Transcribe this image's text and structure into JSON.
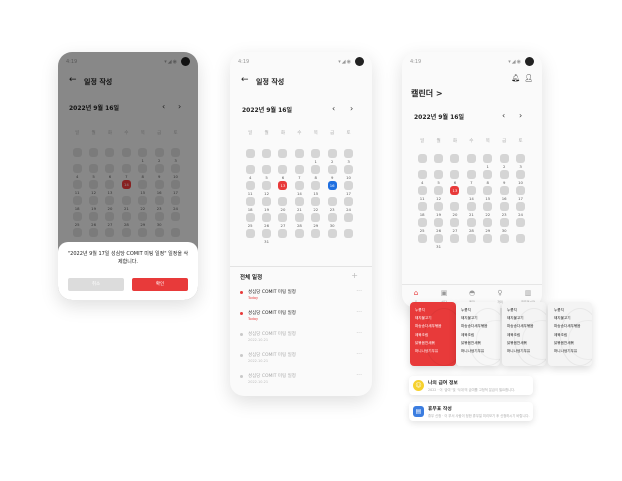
{
  "status": {
    "time": "4:19",
    "icons": "▾◢◉"
  },
  "colors": {
    "accent": "#e83a3a",
    "selected": "#1f6fe0",
    "day_block": "#d5d5d5"
  },
  "icons": {
    "back": "back-arrow-icon",
    "prev": "chevron-left-icon",
    "next": "chevron-right-icon",
    "bell": "bell-icon",
    "profile": "person-icon"
  },
  "weekdays": [
    "일",
    "월",
    "화",
    "수",
    "목",
    "금",
    "토"
  ],
  "screen1": {
    "title": "일정 작성",
    "month": "2022년 9월 16일",
    "dialog": {
      "message": "\"2022년 9월 17일 성심당 COMIT 미팅 일정\" 일정을 삭제합니다.",
      "cancel": "취소",
      "confirm": "확인"
    }
  },
  "screen2": {
    "title": "일정 작성",
    "month": "2022년 9월 16일",
    "list_title": "전체 일정",
    "add": "+",
    "events": [
      {
        "name": "성심당 COMIT 미팅 일정",
        "date": "Today"
      },
      {
        "name": "성심당 COMIT 미팅 일정",
        "date": "Today"
      },
      {
        "name": "성심당 COMIT 미팅 일정",
        "date": "2022.10.21"
      },
      {
        "name": "성심당 COMIT 미팅 일정",
        "date": "2022.10.21"
      },
      {
        "name": "성심당 COMIT 미팅 일정",
        "date": "2022.10.21"
      }
    ]
  },
  "screen3": {
    "title": "캘린더 >",
    "month": "2022년 9월 16일",
    "tabs": [
      {
        "icon": "⌂",
        "label": "홈"
      },
      {
        "icon": "▣",
        "label": "식단"
      },
      {
        "icon": "◓",
        "label": "특징"
      },
      {
        "icon": "♀",
        "label": "관리"
      },
      {
        "icon": "▥",
        "label": "질문게시판"
      }
    ]
  },
  "calendar_days": [
    [
      "",
      "",
      "",
      "",
      "1",
      "2",
      "3"
    ],
    [
      "4",
      "5",
      "6",
      "7",
      "8",
      "9",
      "10"
    ],
    [
      "11",
      "12",
      "13",
      "14",
      "15",
      "16",
      "17"
    ],
    [
      "18",
      "19",
      "20",
      "21",
      "22",
      "23",
      "24"
    ],
    [
      "25",
      "26",
      "27",
      "28",
      "29",
      "30",
      ""
    ],
    [
      "",
      "",
      "",
      "",
      "",
      "",
      ""
    ]
  ],
  "calendar_days_2": [
    [
      "",
      "",
      "",
      "",
      "1",
      "2",
      "3"
    ],
    [
      "4",
      "5",
      "6",
      "7",
      "8",
      "9",
      "10"
    ],
    [
      "11",
      "12",
      "13",
      "14",
      "15",
      "16",
      "17"
    ],
    [
      "18",
      "19",
      "20",
      "21",
      "22",
      "23",
      "24"
    ],
    [
      "25",
      "26",
      "27",
      "28",
      "29",
      "30",
      ""
    ],
    [
      "",
      "31",
      "",
      "",
      "",
      "",
      ""
    ]
  ],
  "menus": [
    {
      "items": [
        "누룽지",
        "돼지불고기",
        "파송송다새우볶음",
        "제육조림",
        "닭볶음찬새볶",
        "머니나냉기우유"
      ]
    },
    {
      "items": [
        "누룽지",
        "돼지불고기",
        "파송송다새우볶음",
        "제육조림",
        "닭볶음찬새볶",
        "머니나냉기우유"
      ]
    },
    {
      "items": [
        "누룽지",
        "돼지불고기",
        "파송송다새우볶음",
        "제육조림",
        "닭볶음찬새볶",
        "머니나냉기우유"
      ]
    },
    {
      "items": [
        "누룽지",
        "돼지불고기",
        "파송송다새우볶음",
        "제육조림",
        "닭볶음찬새볶",
        "머니나냉기우유"
      ]
    }
  ],
  "cards": [
    {
      "icon": "☺",
      "title": "나의 급여 정보",
      "sub": "2022 · 이 '급여' 및 '식대'의 급여를 고정적 분급이 필요합니다."
    },
    {
      "icon": "▤",
      "title": "휴무표 작성",
      "sub": "휴무 신청 · 이 부서 사람이 정한 휴무일 미리보기 후 신청하시기 바랍니다."
    }
  ]
}
